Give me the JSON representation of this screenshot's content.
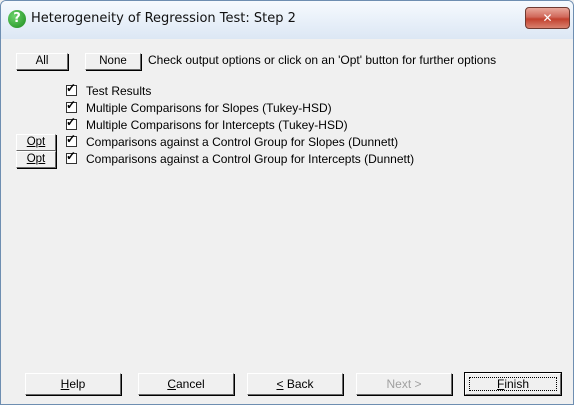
{
  "window": {
    "title": "Heterogeneity of Regression Test: Step 2",
    "icon": "question-icon",
    "close_glyph": "✕"
  },
  "toolbar": {
    "all_label": "All",
    "none_label": "None",
    "hint": "Check output options or click on an 'Opt' button for further options"
  },
  "options": [
    {
      "label": "Test Results",
      "checked": true,
      "has_opt": false
    },
    {
      "label": "Multiple Comparisons for Slopes (Tukey-HSD)",
      "checked": true,
      "has_opt": false
    },
    {
      "label": "Multiple Comparisons for Intercepts (Tukey-HSD)",
      "checked": true,
      "has_opt": false
    },
    {
      "label": "Comparisons against a Control Group for Slopes (Dunnett)",
      "checked": true,
      "has_opt": true,
      "opt_label": "Opt"
    },
    {
      "label": "Comparisons against a Control Group for Intercepts (Dunnett)",
      "checked": true,
      "has_opt": true,
      "opt_label": "Opt"
    }
  ],
  "footer": {
    "help": {
      "label": "Help",
      "mnemonic": "H",
      "rest": "elp"
    },
    "cancel": {
      "label": "Cancel",
      "mnemonic": "C",
      "rest": "ancel"
    },
    "back": {
      "label": "< Back",
      "pre": "",
      "mnemonic": "<",
      "rest": " Back"
    },
    "next": {
      "label": "Next >",
      "text": "Next >",
      "enabled": false
    },
    "finish": {
      "label": "Finish",
      "mnemonic": "F",
      "rest": "inish",
      "default": true
    }
  }
}
